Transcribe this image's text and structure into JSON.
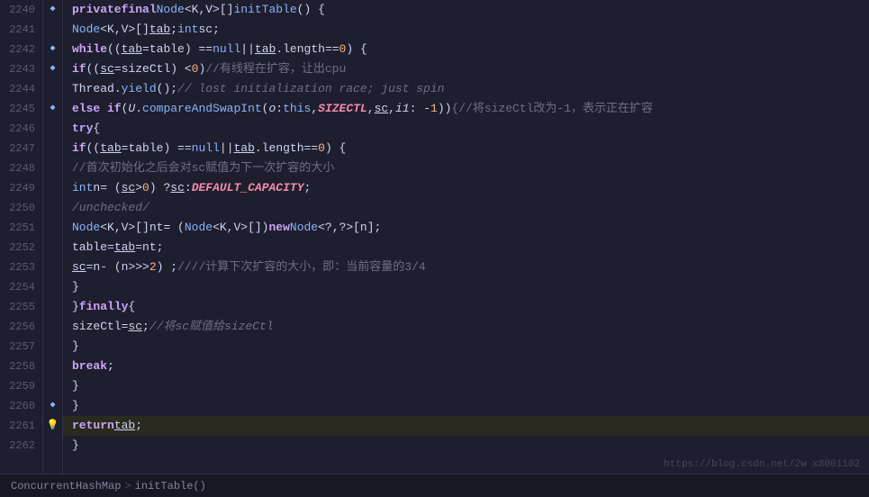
{
  "editor": {
    "lines": [
      {
        "num": "2240",
        "gutter": "bookmark",
        "indent": 0,
        "tokens": [
          {
            "t": "kw",
            "v": "    private "
          },
          {
            "t": "kw",
            "v": "final "
          },
          {
            "t": "kw2",
            "v": "Node"
          },
          {
            "t": "op",
            "v": "<K,V>[] "
          },
          {
            "t": "fn",
            "v": "initTable"
          },
          {
            "t": "op",
            "v": "() {"
          }
        ]
      },
      {
        "num": "2241",
        "gutter": "",
        "indent": 0,
        "tokens": [
          {
            "t": "kw2",
            "v": "        Node"
          },
          {
            "t": "op",
            "v": "<K,V>[] "
          },
          {
            "t": "var-underline",
            "v": "tab"
          },
          {
            "t": "op",
            "v": "; "
          },
          {
            "t": "kw2",
            "v": "int "
          },
          {
            "t": "var",
            "v": "sc"
          },
          {
            "t": "op",
            "v": ";"
          }
        ]
      },
      {
        "num": "2242",
        "gutter": "bookmark",
        "indent": 0,
        "tokens": [
          {
            "t": "kw",
            "v": "        while "
          },
          {
            "t": "op",
            "v": "(("
          },
          {
            "t": "var-underline",
            "v": "tab"
          },
          {
            "t": "op",
            "v": " = "
          },
          {
            "t": "var",
            "v": "table"
          },
          {
            "t": "op",
            "v": ") == "
          },
          {
            "t": "kw2",
            "v": "null "
          },
          {
            "t": "op",
            "v": "|| "
          },
          {
            "t": "var-underline",
            "v": "tab"
          },
          {
            "t": "op",
            "v": "."
          },
          {
            "t": "var",
            "v": "length"
          },
          {
            "t": "op",
            "v": " == "
          },
          {
            "t": "num",
            "v": "0"
          },
          {
            "t": "op",
            "v": ") {"
          }
        ]
      },
      {
        "num": "2243",
        "gutter": "bookmark",
        "indent": 0,
        "tokens": [
          {
            "t": "kw",
            "v": "            if "
          },
          {
            "t": "op",
            "v": "(("
          },
          {
            "t": "var-underline",
            "v": "sc"
          },
          {
            "t": "op",
            "v": " = "
          },
          {
            "t": "var",
            "v": "sizeCtl"
          },
          {
            "t": "op",
            "v": ") < "
          },
          {
            "t": "num",
            "v": "0"
          },
          {
            "t": "op",
            "v": ") "
          },
          {
            "t": "cmt-cn",
            "v": "//有线程在扩容，让出cpu"
          }
        ]
      },
      {
        "num": "2244",
        "gutter": "",
        "indent": 0,
        "tokens": [
          {
            "t": "var",
            "v": "                Thread"
          },
          {
            "t": "op",
            "v": "."
          },
          {
            "t": "fn",
            "v": "yield"
          },
          {
            "t": "op",
            "v": "(); "
          },
          {
            "t": "cmt",
            "v": "// lost initialization race; just spin"
          }
        ]
      },
      {
        "num": "2245",
        "gutter": "bookmark",
        "indent": 0,
        "tokens": [
          {
            "t": "kw",
            "v": "            else if "
          },
          {
            "t": "op",
            "v": "("
          },
          {
            "t": "italic",
            "v": "U"
          },
          {
            "t": "op",
            "v": "."
          },
          {
            "t": "fn",
            "v": "compareAndSwapInt"
          },
          {
            "t": "op",
            "v": "( "
          },
          {
            "t": "italic",
            "v": "o"
          },
          {
            "t": "op",
            "v": ": "
          },
          {
            "t": "kw2",
            "v": "this"
          },
          {
            "t": "op",
            "v": ", "
          },
          {
            "t": "const",
            "v": "SIZECTL"
          },
          {
            "t": "op",
            "v": ", "
          },
          {
            "t": "var-underline",
            "v": "sc"
          },
          {
            "t": "op",
            "v": ",  "
          },
          {
            "t": "italic",
            "v": "i1"
          },
          {
            "t": "op",
            "v": ": -"
          },
          {
            "t": "num",
            "v": "1"
          },
          {
            "t": "op",
            "v": ")) "
          },
          {
            "t": "cmt-cn",
            "v": "   {//将sizeCtl改为-1，表示正在扩容"
          }
        ]
      },
      {
        "num": "2246",
        "gutter": "",
        "indent": 0,
        "tokens": [
          {
            "t": "kw",
            "v": "                try "
          },
          {
            "t": "op",
            "v": "{"
          }
        ]
      },
      {
        "num": "2247",
        "gutter": "",
        "indent": 0,
        "tokens": [
          {
            "t": "kw",
            "v": "                    if "
          },
          {
            "t": "op",
            "v": "(("
          },
          {
            "t": "var-underline",
            "v": "tab"
          },
          {
            "t": "op",
            "v": " = "
          },
          {
            "t": "var",
            "v": "table"
          },
          {
            "t": "op",
            "v": ") == "
          },
          {
            "t": "kw2",
            "v": "null "
          },
          {
            "t": "op",
            "v": "|| "
          },
          {
            "t": "var-underline",
            "v": "tab"
          },
          {
            "t": "op",
            "v": "."
          },
          {
            "t": "var",
            "v": "length"
          },
          {
            "t": "op",
            "v": " == "
          },
          {
            "t": "num",
            "v": "0"
          },
          {
            "t": "op",
            "v": ") {"
          }
        ]
      },
      {
        "num": "2248",
        "gutter": "",
        "indent": 0,
        "tokens": [
          {
            "t": "cmt-cn",
            "v": "                        //首次初始化之后会对sc赋值为下一次扩容的大小"
          }
        ]
      },
      {
        "num": "2249",
        "gutter": "",
        "indent": 0,
        "tokens": [
          {
            "t": "kw2",
            "v": "                        int "
          },
          {
            "t": "var",
            "v": "n"
          },
          {
            "t": "op",
            "v": " = ("
          },
          {
            "t": "var-underline",
            "v": "sc"
          },
          {
            "t": "op",
            "v": " > "
          },
          {
            "t": "num",
            "v": "0"
          },
          {
            "t": "op",
            "v": ") ? "
          },
          {
            "t": "var-underline",
            "v": "sc"
          },
          {
            "t": "op",
            "v": " : "
          },
          {
            "t": "const",
            "v": "DEFAULT_CAPACITY"
          },
          {
            "t": "op",
            "v": ";"
          }
        ]
      },
      {
        "num": "2250",
        "gutter": "",
        "indent": 0,
        "tokens": [
          {
            "t": "cmt",
            "v": "                        /unchecked/"
          }
        ]
      },
      {
        "num": "2251",
        "gutter": "",
        "indent": 0,
        "tokens": [
          {
            "t": "kw2",
            "v": "                        Node"
          },
          {
            "t": "op",
            "v": "<K,V>[] "
          },
          {
            "t": "var",
            "v": "nt"
          },
          {
            "t": "op",
            "v": " = ("
          },
          {
            "t": "kw2",
            "v": "Node"
          },
          {
            "t": "op",
            "v": "<K,V>[])"
          },
          {
            "t": "kw",
            "v": "new "
          },
          {
            "t": "kw2",
            "v": "Node"
          },
          {
            "t": "op",
            "v": "<?,?>["
          },
          {
            "t": "var",
            "v": "n"
          },
          {
            "t": "op",
            "v": "];"
          }
        ]
      },
      {
        "num": "2252",
        "gutter": "",
        "indent": 0,
        "tokens": [
          {
            "t": "var",
            "v": "                        table"
          },
          {
            "t": "op",
            "v": " = "
          },
          {
            "t": "var-underline",
            "v": "tab"
          },
          {
            "t": "op",
            "v": " = "
          },
          {
            "t": "var",
            "v": "nt"
          },
          {
            "t": "op",
            "v": ";"
          }
        ]
      },
      {
        "num": "2253",
        "gutter": "",
        "indent": 0,
        "tokens": [
          {
            "t": "var-underline",
            "v": "                        sc"
          },
          {
            "t": "op",
            "v": " = "
          },
          {
            "t": "var",
            "v": "n"
          },
          {
            "t": "op",
            "v": " - ("
          },
          {
            "t": "var",
            "v": "n"
          },
          {
            "t": "op",
            "v": " >>> "
          },
          {
            "t": "num",
            "v": "2"
          },
          {
            "t": "op",
            "v": ") ;"
          },
          {
            "t": "cmt-cn",
            "v": "////计算下次扩容的大小，即：当前容量的3/4"
          }
        ]
      },
      {
        "num": "2254",
        "gutter": "",
        "indent": 0,
        "tokens": [
          {
            "t": "op",
            "v": "                    }"
          }
        ]
      },
      {
        "num": "2255",
        "gutter": "",
        "indent": 0,
        "tokens": [
          {
            "t": "op",
            "v": "                } "
          },
          {
            "t": "kw",
            "v": "finally "
          },
          {
            "t": "op",
            "v": "{"
          }
        ]
      },
      {
        "num": "2256",
        "gutter": "",
        "indent": 0,
        "tokens": [
          {
            "t": "var",
            "v": "                    sizeCtl"
          },
          {
            "t": "op",
            "v": " = "
          },
          {
            "t": "var-underline",
            "v": "sc"
          },
          {
            "t": "op",
            "v": ";"
          },
          {
            "t": "cmt",
            "v": "//将sc赋值给sizeCtl"
          }
        ]
      },
      {
        "num": "2257",
        "gutter": "",
        "indent": 0,
        "tokens": [
          {
            "t": "op",
            "v": "                }"
          }
        ]
      },
      {
        "num": "2258",
        "gutter": "",
        "indent": 0,
        "tokens": [
          {
            "t": "kw",
            "v": "                break"
          },
          {
            "t": "op",
            "v": ";"
          }
        ]
      },
      {
        "num": "2259",
        "gutter": "",
        "indent": 0,
        "tokens": [
          {
            "t": "op",
            "v": "            }"
          }
        ]
      },
      {
        "num": "2260",
        "gutter": "bookmark",
        "indent": 0,
        "tokens": [
          {
            "t": "op",
            "v": "        }"
          }
        ]
      },
      {
        "num": "2261",
        "gutter": "bulb",
        "indent": 0,
        "highlighted": true,
        "tokens": [
          {
            "t": "kw",
            "v": "        return "
          },
          {
            "t": "var-underline",
            "v": "tab"
          },
          {
            "t": "op",
            "v": ";"
          }
        ]
      },
      {
        "num": "2262",
        "gutter": "",
        "indent": 0,
        "tokens": [
          {
            "t": "op",
            "v": "    }"
          }
        ]
      }
    ],
    "status": {
      "breadcrumb1": "ConcurrentHashMap",
      "sep": ">",
      "breadcrumb2": "initTable()",
      "watermark": "https://blog.csdn.net/2w x8001102"
    }
  }
}
